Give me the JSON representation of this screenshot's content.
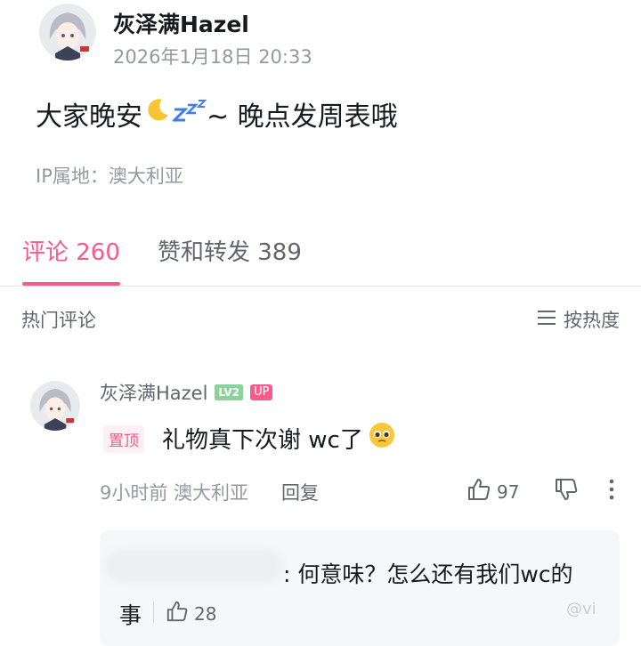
{
  "post": {
    "author": "灰泽满Hazel",
    "time": "2026年1月18日 20:33",
    "content_before": "大家晚安",
    "content_after": " ~ 晚点发周表哦",
    "ip": "IP属地：澳大利亚"
  },
  "tabs": {
    "comments": "评论 260",
    "reposts": "赞和转发 389"
  },
  "comment_section": {
    "title": "热门评论",
    "sort_label": "按热度"
  },
  "top_comment": {
    "author": "灰泽满Hazel",
    "level_badge": "LV2",
    "up_badge": "UP",
    "pinned_label": "置顶",
    "text": "礼物真下次谢 wc了",
    "meta": "9小时前 澳大利亚",
    "reply_label": "回复",
    "likes": "97"
  },
  "sub_comment": {
    "text_line1": ": 何意味？怎么还有我们wc的",
    "text_line2": "事",
    "likes": "28"
  },
  "watermark": "@vi",
  "colors": {
    "accent": "#f85a8c",
    "text_primary": "#18191c",
    "text_secondary": "#9499a0"
  }
}
